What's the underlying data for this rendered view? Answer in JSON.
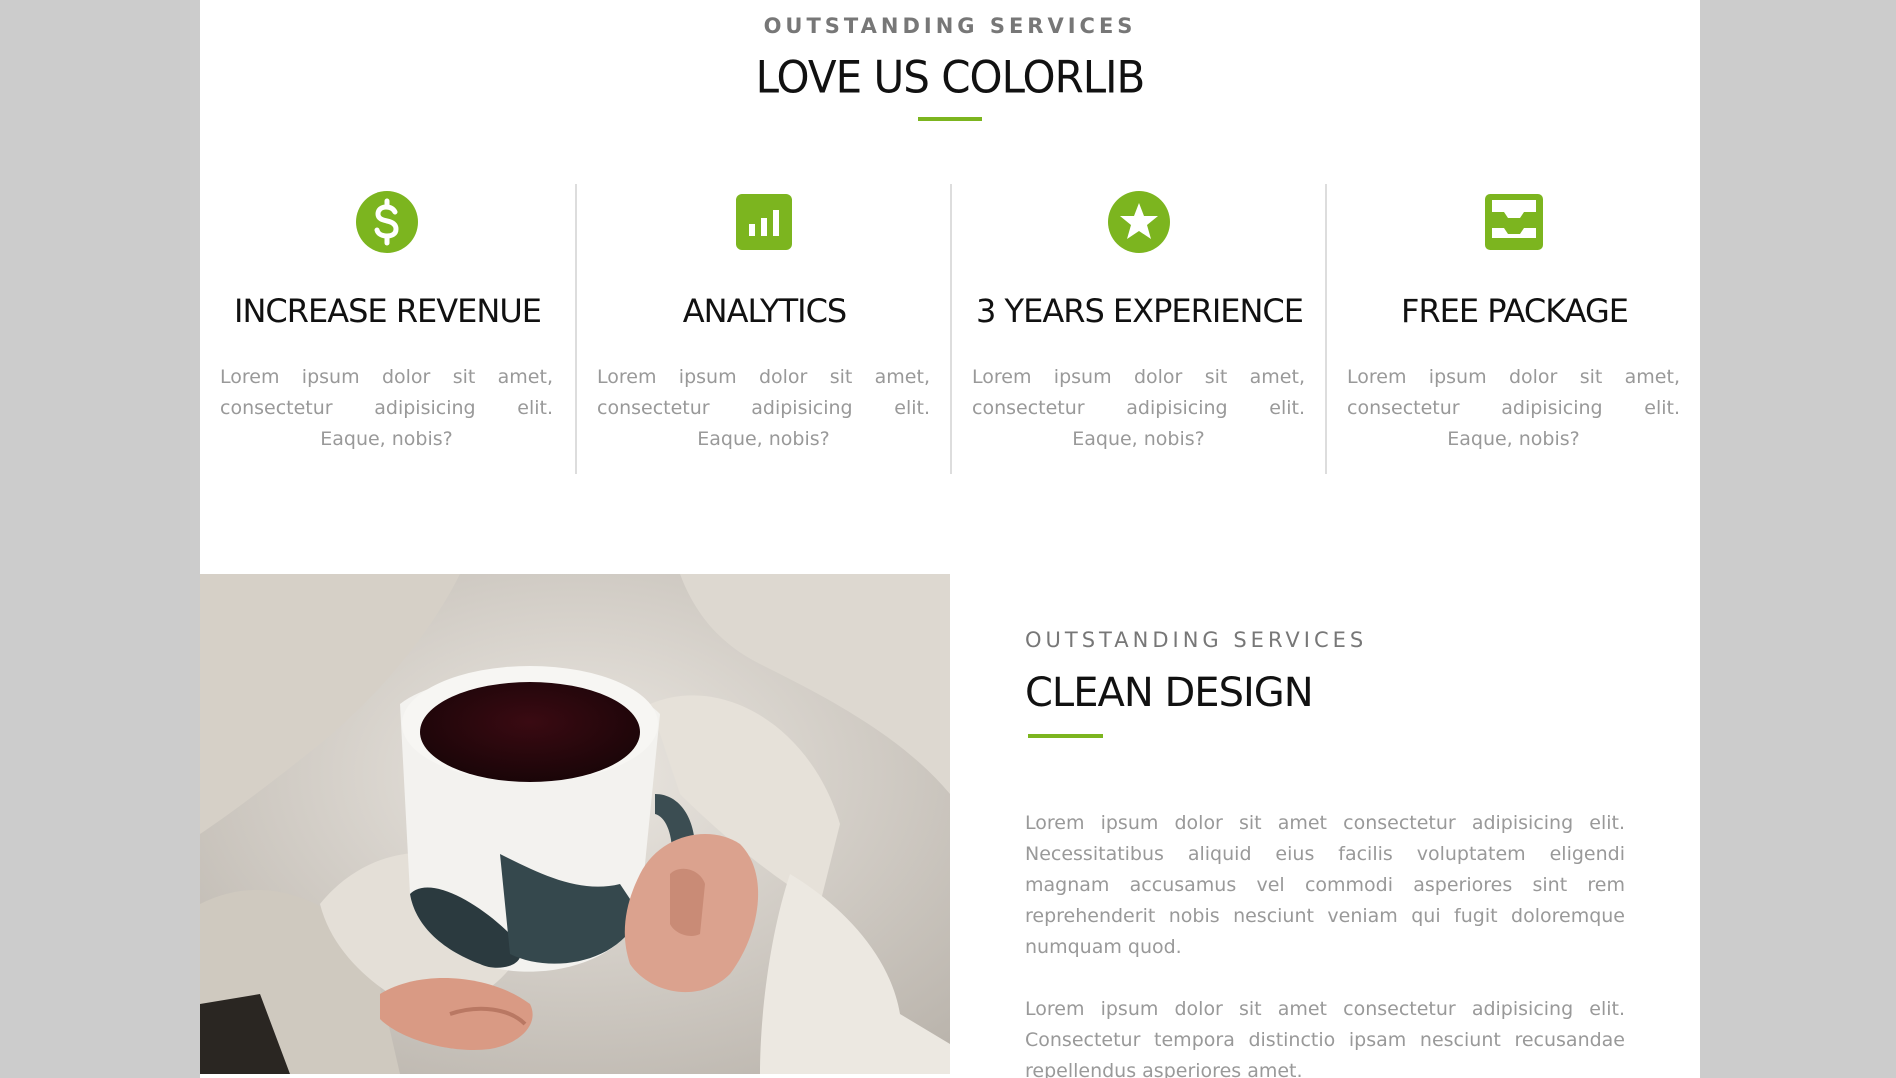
{
  "colors": {
    "accent": "#7cb51f",
    "background_outer": "#cccccc",
    "background_page": "#ffffff",
    "heading": "#111111",
    "body_text": "#999999",
    "eyebrow": "#777777",
    "divider": "#dddddd"
  },
  "services": {
    "eyebrow": "OUTSTANDING SERVICES",
    "title": "LOVE US COLORLIB",
    "features": [
      {
        "icon": "dollar-circle-icon",
        "title": "INCREASE REVENUE",
        "text": "Lorem ipsum dolor sit amet, consectetur adipisicing elit. Eaque, nobis?"
      },
      {
        "icon": "bar-chart-icon",
        "title": "ANALYTICS",
        "text": "Lorem ipsum dolor sit amet, consectetur adipisicing elit. Eaque, nobis?"
      },
      {
        "icon": "star-circle-icon",
        "title": "3 YEARS EXPERIENCE",
        "text": "Lorem ipsum dolor sit amet, consectetur adipisicing elit. Eaque, nobis?"
      },
      {
        "icon": "package-tray-icon",
        "title": "FREE PACKAGE",
        "text": "Lorem ipsum dolor sit amet, consectetur adipisicing elit. Eaque, nobis?"
      }
    ]
  },
  "design": {
    "image": "coffee-mug-photo",
    "eyebrow": "OUTSTANDING SERVICES",
    "title": "CLEAN DESIGN",
    "paragraphs": [
      "Lorem ipsum dolor sit amet consectetur adipisicing elit. Necessitatibus aliquid eius facilis voluptatem eligendi magnam accusamus vel commodi asperiores sint rem reprehenderit nobis nesciunt veniam qui fugit doloremque numquam quod.",
      "Lorem ipsum dolor sit amet consectetur adipisicing elit. Consectetur tempora distinctio ipsam nesciunt recusandae repellendus asperiores amet."
    ]
  }
}
